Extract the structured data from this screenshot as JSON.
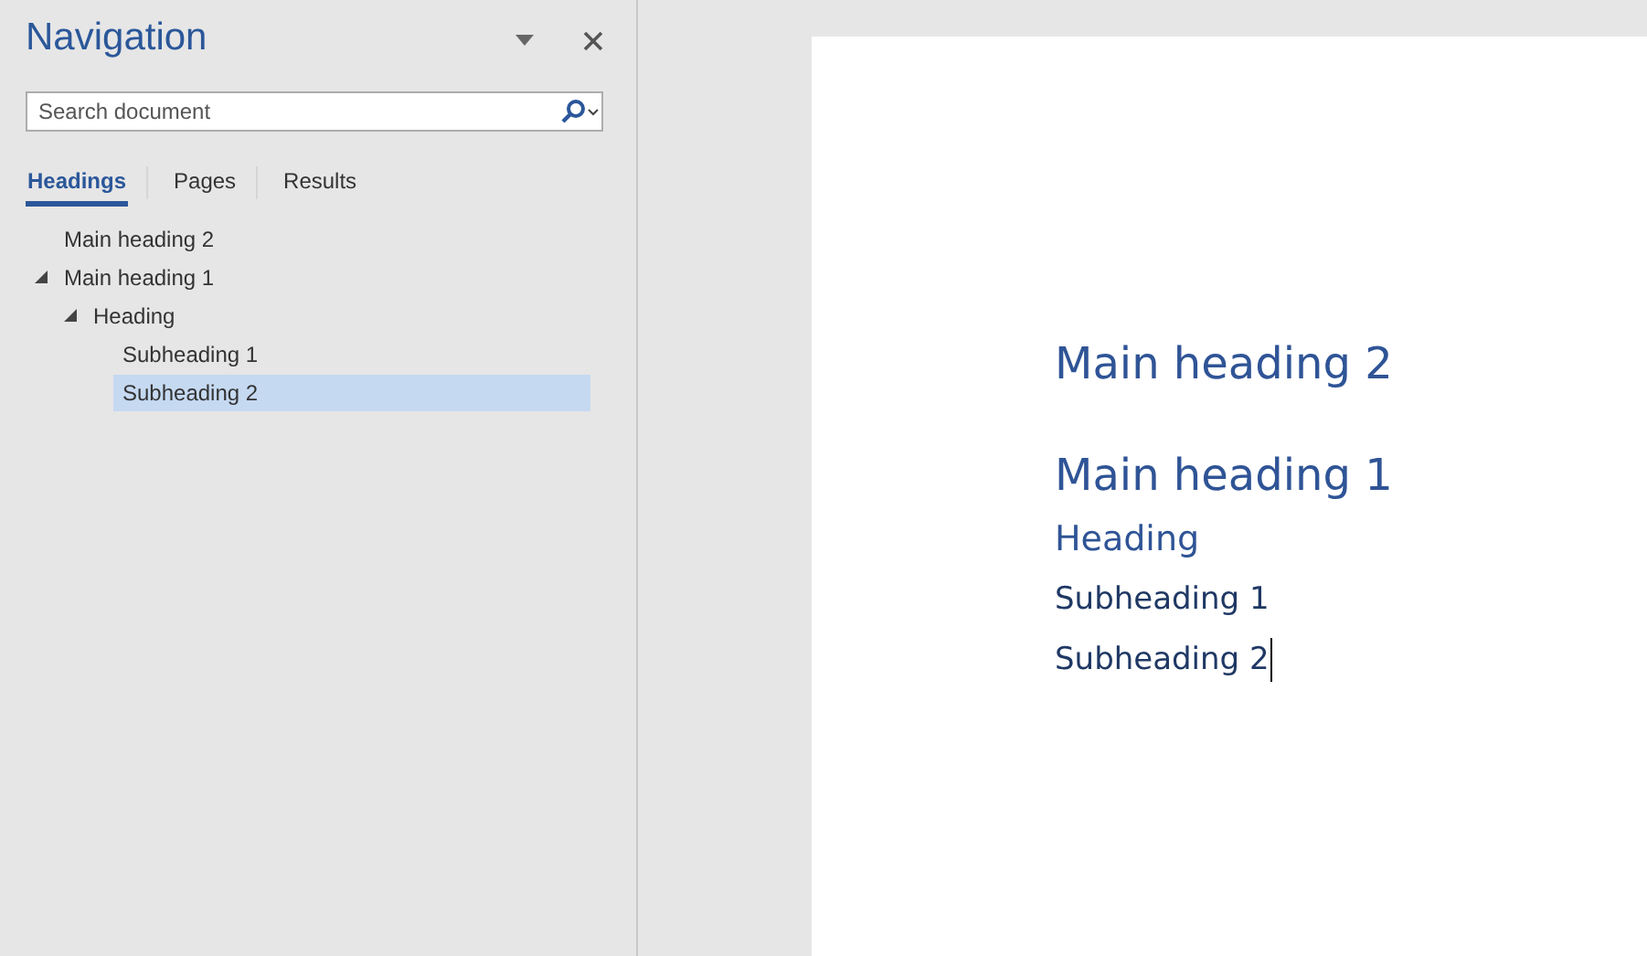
{
  "pane": {
    "title": "Navigation"
  },
  "search": {
    "placeholder": "Search document"
  },
  "tabs": [
    {
      "label": "Headings",
      "selected": true
    },
    {
      "label": "Pages",
      "selected": false
    },
    {
      "label": "Results",
      "selected": false
    }
  ],
  "tree": [
    {
      "label": "Main heading 2",
      "selected": false
    },
    {
      "label": "Main heading 1",
      "expanded": true,
      "selected": false,
      "children": [
        {
          "label": "Heading",
          "expanded": true,
          "selected": false,
          "children": [
            {
              "label": "Subheading 1",
              "selected": false
            },
            {
              "label": "Subheading 2",
              "selected": true
            }
          ]
        }
      ]
    }
  ],
  "document": {
    "paragraphs": [
      {
        "kind": "heading1",
        "text": "Main heading 2",
        "caret": false
      },
      {
        "kind": "heading1",
        "text": "Main heading 1",
        "caret": false
      },
      {
        "kind": "heading2",
        "text": "Heading",
        "caret": false
      },
      {
        "kind": "heading3",
        "text": "Subheading 1",
        "caret": false
      },
      {
        "kind": "heading3",
        "text": "Subheading 2",
        "caret": true
      }
    ]
  }
}
